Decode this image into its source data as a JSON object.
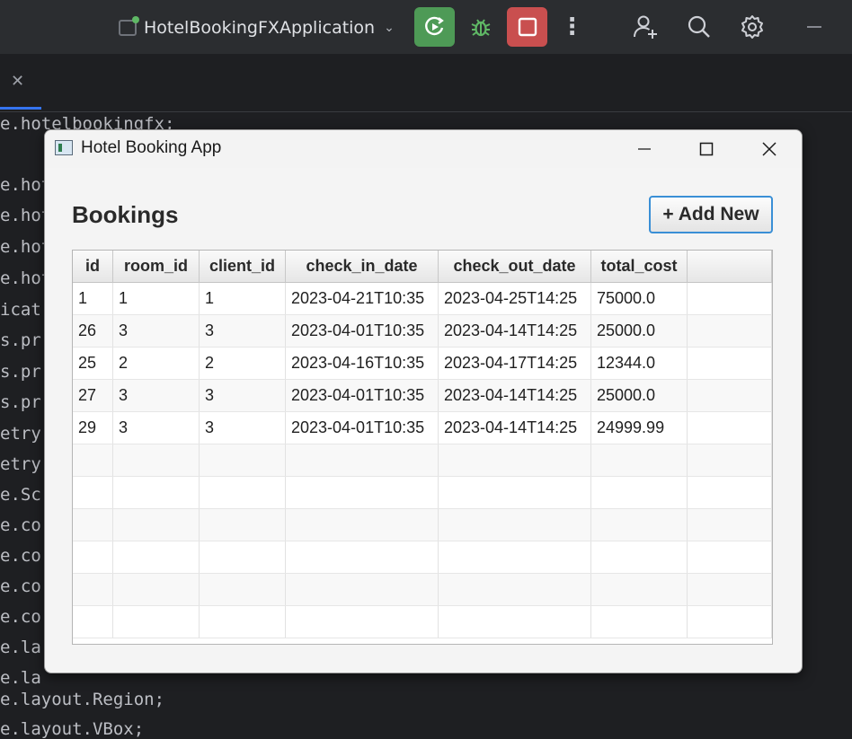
{
  "ide": {
    "run_config": "HotelBookingFXApplication",
    "code_lines": [
      "e.hotelbookingfx;",
      "",
      "e.hot",
      "e.hot",
      "e.hot",
      "e.hot",
      "icat",
      "s.pr",
      "s.pr",
      "s.pr",
      "etry",
      "etry",
      "e.Sc",
      "e.co",
      "e.co",
      "e.co",
      "e.co",
      "e.la",
      "e.la",
      "e.layout.Region;",
      "e.layout.VBox;"
    ]
  },
  "window": {
    "title": "Hotel Booking App"
  },
  "page": {
    "heading": "Bookings",
    "add_button": "+ Add New"
  },
  "table": {
    "columns": [
      "id",
      "room_id",
      "client_id",
      "check_in_date",
      "check_out_date",
      "total_cost",
      ""
    ],
    "rows": [
      [
        "1",
        "1",
        "1",
        "2023-04-21T10:35",
        "2023-04-25T14:25",
        "75000.0"
      ],
      [
        "26",
        "3",
        "3",
        "2023-04-01T10:35",
        "2023-04-14T14:25",
        "25000.0"
      ],
      [
        "25",
        "2",
        "2",
        "2023-04-16T10:35",
        "2023-04-17T14:25",
        "12344.0"
      ],
      [
        "27",
        "3",
        "3",
        "2023-04-01T10:35",
        "2023-04-14T14:25",
        "25000.0"
      ],
      [
        "29",
        "3",
        "3",
        "2023-04-01T10:35",
        "2023-04-14T14:25",
        "24999.99"
      ]
    ]
  },
  "colors": {
    "ide_background": "#1e1f22",
    "rerun_button": "#4e9a56",
    "stop_button": "#c94f4f",
    "focus_border": "#3a8fd6"
  }
}
